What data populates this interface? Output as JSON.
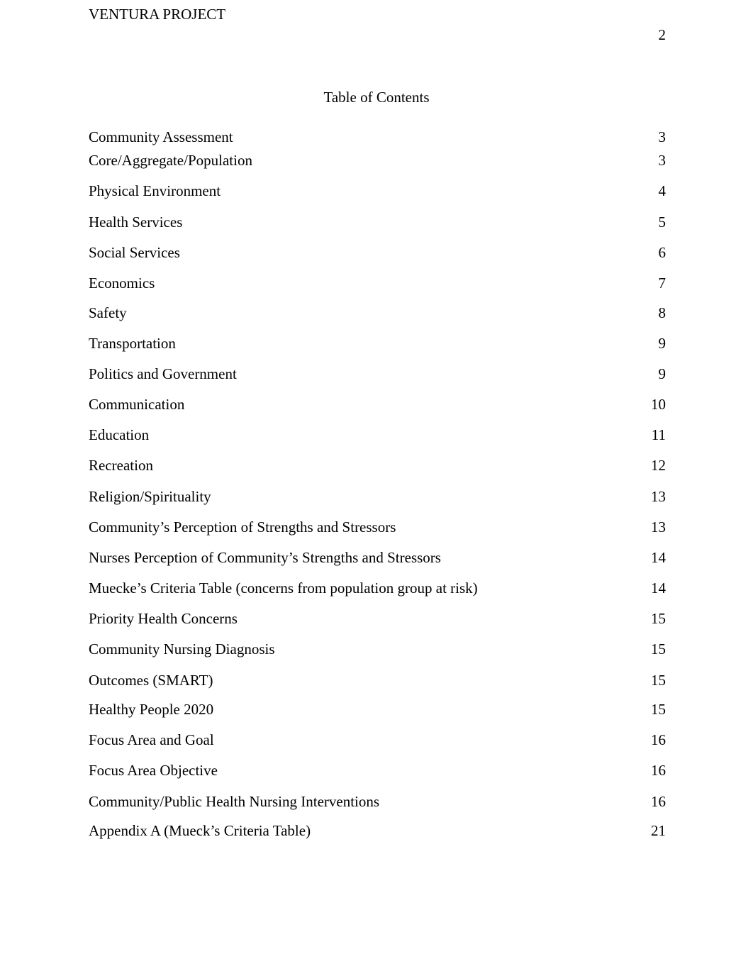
{
  "header": {
    "running_head": "VENTURA PROJECT",
    "page_number": "2"
  },
  "toc": {
    "title": "Table of Contents",
    "entries": [
      {
        "label": "Community Assessment",
        "page": "3"
      },
      {
        "label": "Core/Aggregate/Population",
        "page": "3"
      },
      {
        "label": "Physical Environment",
        "page": "4"
      },
      {
        "label": "Health Services",
        "page": "5"
      },
      {
        "label": "Social Services",
        "page": "6"
      },
      {
        "label": "Economics",
        "page": "7"
      },
      {
        "label": "Safety",
        "page": "8"
      },
      {
        "label": "Transportation",
        "page": "9"
      },
      {
        "label": "Politics and Government",
        "page": "9"
      },
      {
        "label": "Communication",
        "page": "10"
      },
      {
        "label": "Education",
        "page": "11"
      },
      {
        "label": "Recreation",
        "page": "12"
      },
      {
        "label": "Religion/Spirituality",
        "page": "13"
      },
      {
        "label": "Community’s Perception of Strengths and Stressors",
        "page": "13"
      },
      {
        "label": "Nurses Perception of Community’s Strengths and Stressors",
        "page": "14"
      },
      {
        "label": "Muecke’s Criteria Table (concerns from population group at risk)",
        "page": "14"
      },
      {
        "label": "Priority Health Concerns",
        "page": "15"
      },
      {
        "label": "Community Nursing Diagnosis",
        "page": "15"
      },
      {
        "label": "Outcomes (SMART)",
        "page": "15"
      },
      {
        "label": "Healthy People 2020",
        "page": "15"
      },
      {
        "label": "Focus Area and Goal",
        "page": "16"
      },
      {
        "label": "Focus Area Objective",
        "page": "16"
      },
      {
        "label": "Community/Public Health Nursing Interventions",
        "page": "16"
      },
      {
        "label": "Appendix A (Mueck’s Criteria Table)",
        "page": "21"
      }
    ]
  }
}
